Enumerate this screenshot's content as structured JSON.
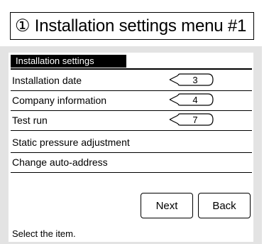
{
  "title": "① Installation settings menu #1",
  "screen": {
    "header": "Installation settings",
    "items": [
      {
        "label": "Installation date",
        "callout": "3"
      },
      {
        "label": "Company information",
        "callout": "4"
      },
      {
        "label": "Test run",
        "callout": "7"
      },
      {
        "label": "Static pressure adjustment",
        "callout": ""
      },
      {
        "label": "Change auto-address",
        "callout": ""
      }
    ],
    "next_label": "Next",
    "back_label": "Back",
    "status": "Select the item."
  }
}
